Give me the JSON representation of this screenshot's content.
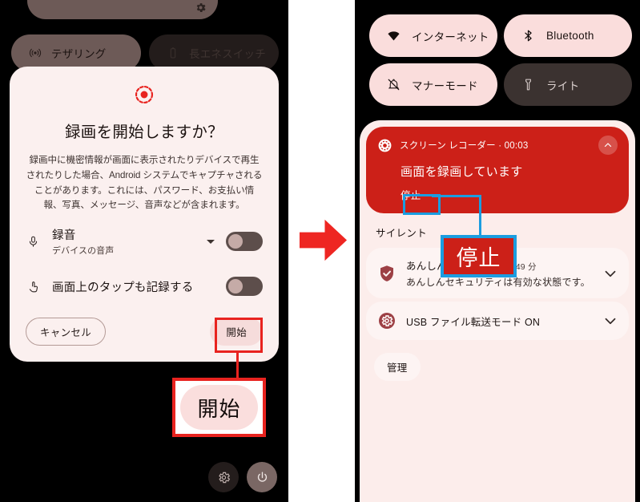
{
  "left_screen": {
    "quick_settings": {
      "top_partial_tile": {
        "icon": "gear-icon"
      },
      "tiles": [
        {
          "label": "テザリング",
          "icon": "tethering-icon",
          "state": "on"
        },
        {
          "label": "長エネスイッチ",
          "icon": "battery-icon",
          "state": "off"
        }
      ]
    },
    "dialog": {
      "icon": "screen-record-icon",
      "title": "録画を開始しますか？",
      "body": "録画中に機密情報が画面に表示されたりデバイスで再生されたりした場合、Android システムでキャプチャされることがあります。これには、パスワード、お支払い情報、写真、メッセージ、音声などが含まれます。",
      "options": [
        {
          "icon": "microphone-icon",
          "title": "録音",
          "subtitle": "デバイスの音声",
          "has_dropdown": true,
          "toggle_state": "off"
        },
        {
          "icon": "tap-record-icon",
          "title": "画面上のタップも記録する",
          "subtitle": "",
          "has_dropdown": false,
          "toggle_state": "off"
        }
      ],
      "cancel_label": "キャンセル",
      "start_label": "開始"
    },
    "callout": {
      "label": "開始",
      "border_color": "#e8231f"
    },
    "bottom_buttons": [
      {
        "icon": "gear-icon",
        "name": "settings-button"
      },
      {
        "icon": "power-icon",
        "name": "power-button"
      }
    ]
  },
  "arrow": {
    "color": "#ee2622",
    "direction": "right"
  },
  "right_screen": {
    "quick_settings": [
      {
        "label": "インターネット",
        "icon": "wifi-icon",
        "state": "on",
        "chevron": "›"
      },
      {
        "label": "Bluetooth",
        "icon": "bluetooth-icon",
        "state": "on",
        "chevron": ""
      },
      {
        "label": "マナーモード",
        "icon": "bell-off-icon",
        "state": "on",
        "chevron": ""
      },
      {
        "label": "ライト",
        "icon": "flashlight-icon",
        "state": "off",
        "chevron": ""
      }
    ],
    "recording_notification": {
      "icon": "screen-record-icon",
      "app_line": "スクリーン レコーダー · 00:03",
      "title": "画面を録画しています",
      "action_label": "停止",
      "collapse_icon": "chevron-up-icon",
      "background_color": "#cc2018"
    },
    "callout": {
      "label": "停止",
      "border_color": "#1b9de0",
      "fill_color": "#cc2018"
    },
    "silent_header": "サイレント",
    "notifications": [
      {
        "icon": "shield-check-icon",
        "title": "あんしんセキュリティ",
        "timestamp": "· 49 分",
        "subtitle": "あんしんセキュリティは有効な状態です。",
        "chevron": "chevron-down-icon"
      },
      {
        "icon": "gear-icon",
        "title": "USB ファイル転送モード ON",
        "timestamp": "",
        "subtitle": "",
        "chevron": "chevron-down-icon"
      }
    ],
    "manage_label": "管理"
  }
}
